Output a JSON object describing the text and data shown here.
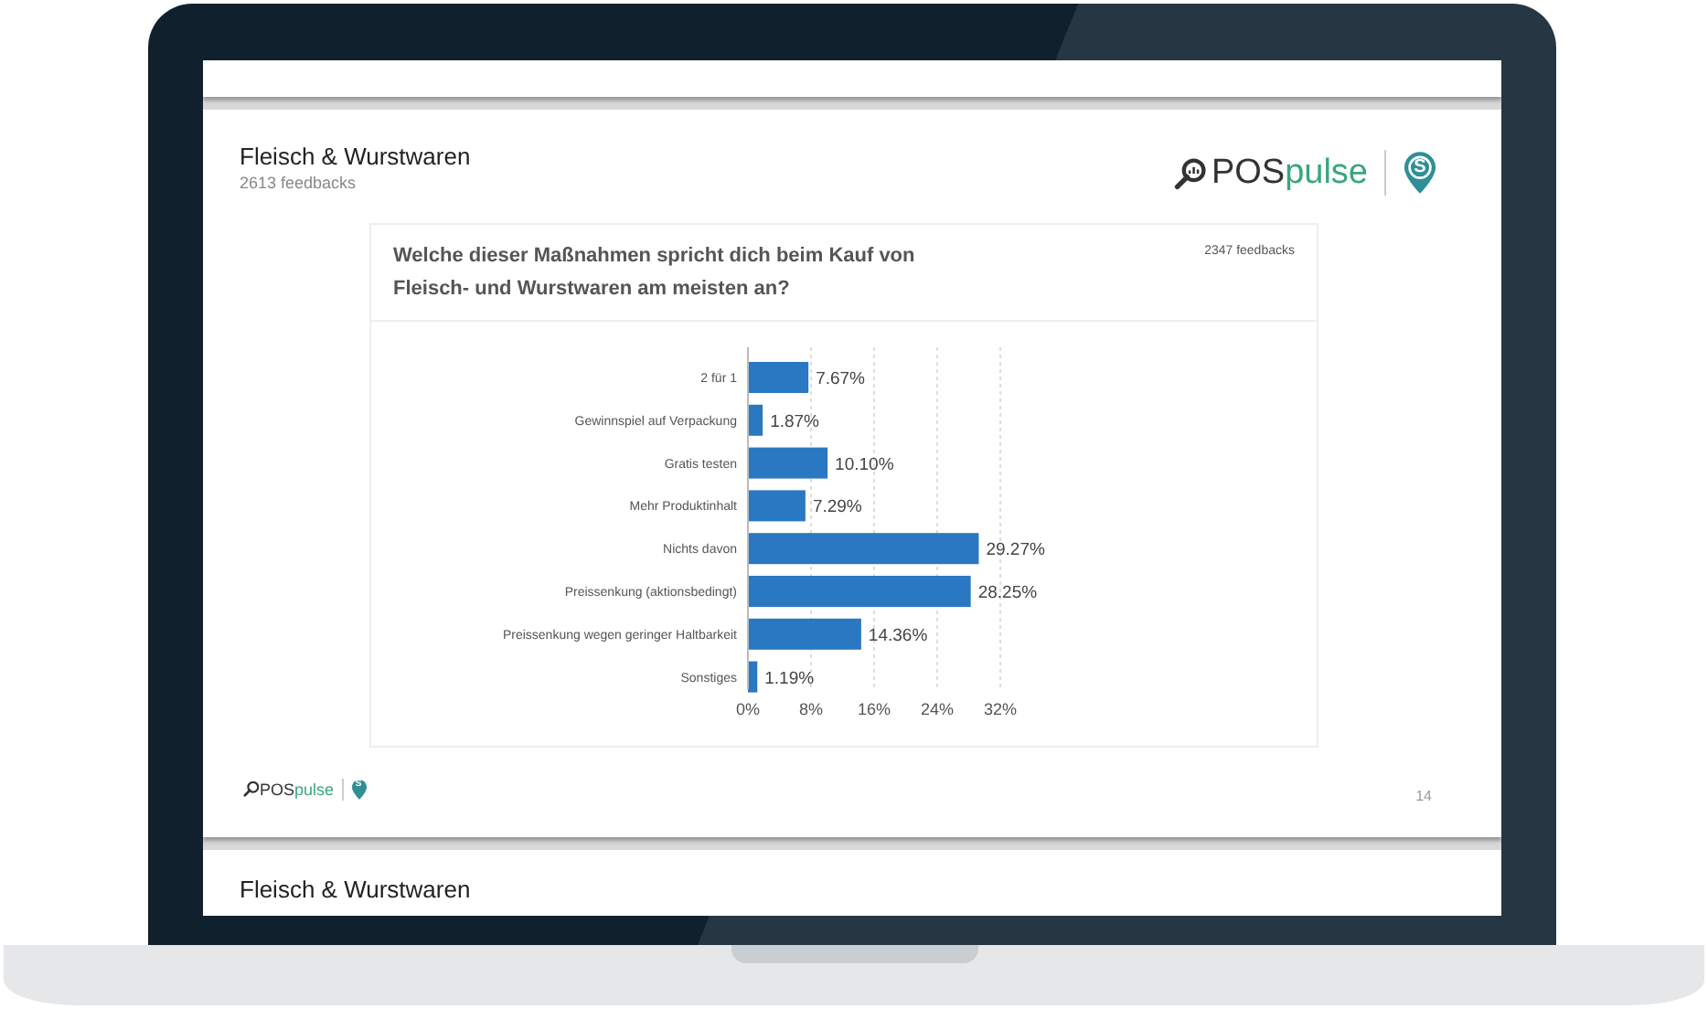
{
  "slide": {
    "title": "Fleisch & Wurstwaren",
    "subtitle": "2613 feedbacks",
    "logo": {
      "brand_part_1": "POS",
      "brand_part_2": "pulse",
      "badge": "S"
    },
    "card": {
      "question": "Welche dieser Maßnahmen spricht dich beim Kauf von Fleisch- und Wurstwaren am meisten an?",
      "count": "2347 feedbacks",
      "chart_data": {
        "type": "bar",
        "orientation": "horizontal",
        "categories": [
          "2 für 1",
          "Gewinnspiel auf Verpackung",
          "Gratis testen",
          "Mehr Produktinhalt",
          "Nichts davon",
          "Preissenkung (aktionsbedingt)",
          "Preissenkung wegen geringer Haltbarkeit",
          "Sonstiges"
        ],
        "values": [
          7.67,
          1.87,
          10.1,
          7.29,
          29.27,
          28.25,
          14.36,
          1.19
        ],
        "grid": true,
        "value_labels": [
          "7.67%",
          "1.87%",
          "10.10%",
          "7.29%",
          "29.27%",
          "28.25%",
          "14.36%",
          "1.19%"
        ],
        "xlim": [
          0,
          32
        ],
        "xticks": [
          {
            "value": 0,
            "label": "0%"
          },
          {
            "value": 8,
            "label": "8%"
          },
          {
            "value": 16,
            "label": "16%"
          },
          {
            "value": 24,
            "label": "24%"
          },
          {
            "value": 32,
            "label": "32%"
          }
        ]
      }
    },
    "footer_logo": {
      "brand_part_1": "POS",
      "brand_part_2": "pulse",
      "badge": "S"
    },
    "page_number": "14"
  },
  "next_slide": {
    "title": "Fleisch & Wurstwaren"
  }
}
